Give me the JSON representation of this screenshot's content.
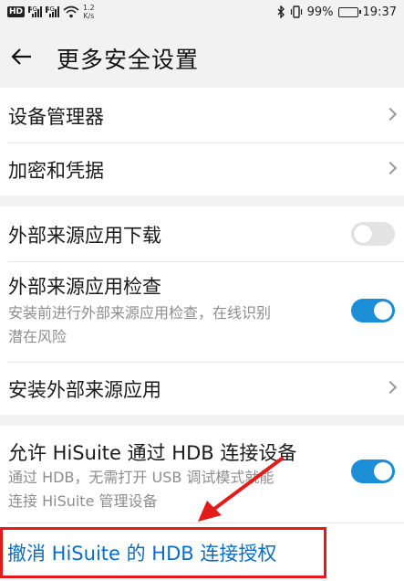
{
  "status_bar": {
    "hd_badge": "HD",
    "sig1_tag": "4G",
    "sig2_tag": "4G",
    "speed_value": "1.2",
    "speed_unit": "K/s",
    "battery_pct": "99%",
    "battery_level": 0.99,
    "time": "19:37",
    "icons": [
      "wifi-icon",
      "bluetooth-icon",
      "vibrate-icon"
    ]
  },
  "header": {
    "back_icon": "arrow-left-icon",
    "title": "更多安全设置"
  },
  "group1": [
    {
      "label": "设备管理器",
      "control": "chevron"
    },
    {
      "label": "加密和凭据",
      "control": "chevron"
    }
  ],
  "group2": {
    "external_download": {
      "label": "外部来源应用下载",
      "toggle": false
    },
    "external_check": {
      "label": "外部来源应用检查",
      "sub1": "安装前进行外部来源应用检查，在线识别",
      "sub2": "潜在风险",
      "toggle": true
    },
    "install_external": {
      "label": "安装外部来源应用",
      "control": "chevron"
    }
  },
  "group3": {
    "hisuite": {
      "label": "允许 HiSuite 通过 HDB 连接设备",
      "sub1": "通过 HDB，无需打开 USB 调试模式就能",
      "sub2": "连接 HiSuite 管理设备",
      "toggle": true
    },
    "revoke": {
      "label": "撤消 HiSuite 的 HDB 连接授权"
    }
  },
  "colors": {
    "accent": "#1a8fd6",
    "link": "#0b6dc1",
    "annotation_red": "#e31b1b"
  }
}
